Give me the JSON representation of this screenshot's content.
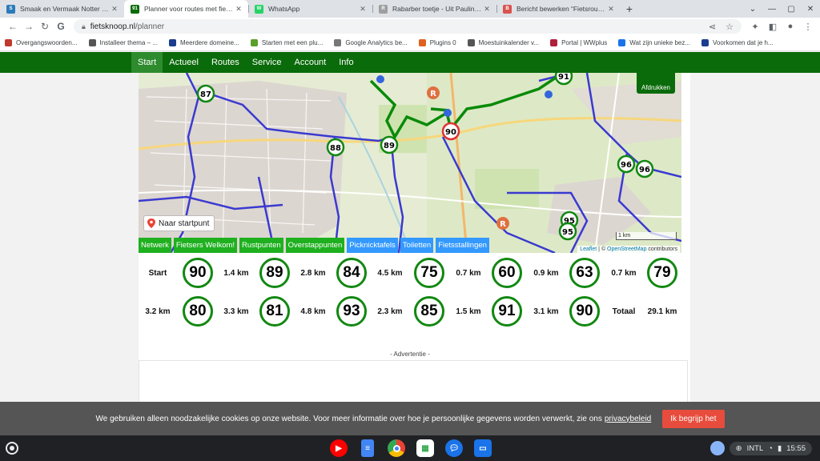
{
  "browser": {
    "tabs": [
      {
        "title": "Smaak en Vermaak Notter - Zuna",
        "fav_color": "#2b7bb9",
        "fav_letter": "S",
        "active": false
      },
      {
        "title": "Planner voor routes met fietskno",
        "fav_color": "#0a6b0a",
        "fav_letter": "91",
        "active": true
      },
      {
        "title": "WhatsApp",
        "fav_color": "#25d366",
        "fav_letter": "W",
        "active": false
      },
      {
        "title": "Rabarber toetje - Uit Paulines Ke",
        "fav_color": "#9e9e9e",
        "fav_letter": "R",
        "active": false
      },
      {
        "title": "Bericht bewerken “Fietsroute lan",
        "fav_color": "#d9534f",
        "fav_letter": "B",
        "active": false
      }
    ],
    "url_domain": "fietsknoop.nl",
    "url_path": "/planner",
    "bookmarks": [
      {
        "label": "Overgangswoorden...",
        "color": "#c0392b"
      },
      {
        "label": "Installeer thema – ...",
        "color": "#555555"
      },
      {
        "label": "Meerdere domeine...",
        "color": "#1a3d8f"
      },
      {
        "label": "Starten met een plu...",
        "color": "#5aa02c"
      },
      {
        "label": "Google Analytics be...",
        "color": "#777777"
      },
      {
        "label": "Plugins 0",
        "color": "#e06020"
      },
      {
        "label": "Moestuinkalender v...",
        "color": "#555555"
      },
      {
        "label": "Portal | WWplus",
        "color": "#b0203a"
      },
      {
        "label": "Wat zijn unieke bez...",
        "color": "#1a73e8"
      },
      {
        "label": "Voorkomen dat je h...",
        "color": "#1a3d8f"
      }
    ]
  },
  "site": {
    "nav": [
      "Start",
      "Actueel",
      "Routes",
      "Service",
      "Account",
      "Info"
    ],
    "nav_active": "Start",
    "print_label": "Afdrukken",
    "startpoint_label": "Naar startpunt",
    "scale_label": "1 km",
    "attribution_leaflet": "Leaflet",
    "attribution_osm": "OpenStreetMap",
    "attribution_rest": "contributors",
    "layers": [
      {
        "label": "Netwerk",
        "color": "green"
      },
      {
        "label": "Fietsers Welkom!",
        "color": "green"
      },
      {
        "label": "Rustpunten",
        "color": "green"
      },
      {
        "label": "Overstappunten",
        "color": "green"
      },
      {
        "label": "Picknicktafels",
        "color": "blue"
      },
      {
        "label": "Toiletten",
        "color": "blue"
      },
      {
        "label": "Fietsstallingen",
        "color": "blue"
      }
    ],
    "map_nodes": [
      {
        "n": "87"
      },
      {
        "n": "88"
      },
      {
        "n": "89"
      },
      {
        "n": "90"
      },
      {
        "n": "91"
      },
      {
        "n": "96"
      },
      {
        "n": "96"
      },
      {
        "n": "95"
      },
      {
        "n": "95"
      }
    ]
  },
  "route": {
    "row1": [
      "Start",
      "90",
      "1.4 km",
      "89",
      "2.8 km",
      "84",
      "4.5 km",
      "75",
      "0.7 km",
      "60",
      "0.9 km",
      "63",
      "0.7 km",
      "79"
    ],
    "row2": [
      "3.2 km",
      "80",
      "3.3 km",
      "81",
      "4.8 km",
      "93",
      "2.3 km",
      "85",
      "1.5 km",
      "91",
      "3.1 km",
      "90",
      "Totaal",
      "29.1 km"
    ]
  },
  "advert_label": "- Advertentie -",
  "cookie": {
    "text": "We gebruiken alleen noodzakelijke cookies op onze website. Voor meer informatie over hoe je persoonlijke gegevens worden verwerkt, zie ons",
    "link": "privacybeleid",
    "button": "Ik begrijp het"
  },
  "shelf": {
    "locale": "INTL",
    "time": "15:55"
  }
}
